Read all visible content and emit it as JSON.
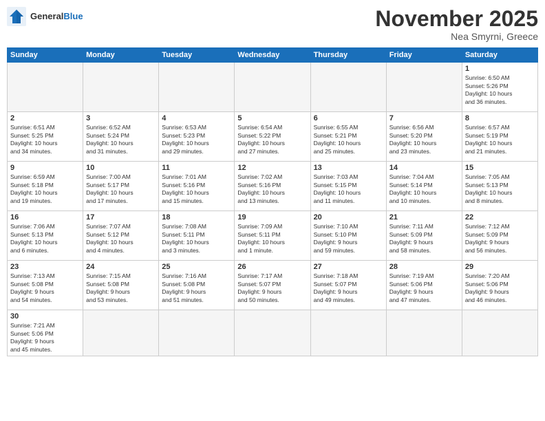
{
  "header": {
    "logo_general": "General",
    "logo_blue": "Blue",
    "month_title": "November 2025",
    "location": "Nea Smyrni, Greece"
  },
  "weekdays": [
    "Sunday",
    "Monday",
    "Tuesday",
    "Wednesday",
    "Thursday",
    "Friday",
    "Saturday"
  ],
  "weeks": [
    [
      {
        "day": "",
        "info": ""
      },
      {
        "day": "",
        "info": ""
      },
      {
        "day": "",
        "info": ""
      },
      {
        "day": "",
        "info": ""
      },
      {
        "day": "",
        "info": ""
      },
      {
        "day": "",
        "info": ""
      },
      {
        "day": "1",
        "info": "Sunrise: 6:50 AM\nSunset: 5:26 PM\nDaylight: 10 hours\nand 36 minutes."
      }
    ],
    [
      {
        "day": "2",
        "info": "Sunrise: 6:51 AM\nSunset: 5:25 PM\nDaylight: 10 hours\nand 34 minutes."
      },
      {
        "day": "3",
        "info": "Sunrise: 6:52 AM\nSunset: 5:24 PM\nDaylight: 10 hours\nand 31 minutes."
      },
      {
        "day": "4",
        "info": "Sunrise: 6:53 AM\nSunset: 5:23 PM\nDaylight: 10 hours\nand 29 minutes."
      },
      {
        "day": "5",
        "info": "Sunrise: 6:54 AM\nSunset: 5:22 PM\nDaylight: 10 hours\nand 27 minutes."
      },
      {
        "day": "6",
        "info": "Sunrise: 6:55 AM\nSunset: 5:21 PM\nDaylight: 10 hours\nand 25 minutes."
      },
      {
        "day": "7",
        "info": "Sunrise: 6:56 AM\nSunset: 5:20 PM\nDaylight: 10 hours\nand 23 minutes."
      },
      {
        "day": "8",
        "info": "Sunrise: 6:57 AM\nSunset: 5:19 PM\nDaylight: 10 hours\nand 21 minutes."
      }
    ],
    [
      {
        "day": "9",
        "info": "Sunrise: 6:59 AM\nSunset: 5:18 PM\nDaylight: 10 hours\nand 19 minutes."
      },
      {
        "day": "10",
        "info": "Sunrise: 7:00 AM\nSunset: 5:17 PM\nDaylight: 10 hours\nand 17 minutes."
      },
      {
        "day": "11",
        "info": "Sunrise: 7:01 AM\nSunset: 5:16 PM\nDaylight: 10 hours\nand 15 minutes."
      },
      {
        "day": "12",
        "info": "Sunrise: 7:02 AM\nSunset: 5:16 PM\nDaylight: 10 hours\nand 13 minutes."
      },
      {
        "day": "13",
        "info": "Sunrise: 7:03 AM\nSunset: 5:15 PM\nDaylight: 10 hours\nand 11 minutes."
      },
      {
        "day": "14",
        "info": "Sunrise: 7:04 AM\nSunset: 5:14 PM\nDaylight: 10 hours\nand 10 minutes."
      },
      {
        "day": "15",
        "info": "Sunrise: 7:05 AM\nSunset: 5:13 PM\nDaylight: 10 hours\nand 8 minutes."
      }
    ],
    [
      {
        "day": "16",
        "info": "Sunrise: 7:06 AM\nSunset: 5:13 PM\nDaylight: 10 hours\nand 6 minutes."
      },
      {
        "day": "17",
        "info": "Sunrise: 7:07 AM\nSunset: 5:12 PM\nDaylight: 10 hours\nand 4 minutes."
      },
      {
        "day": "18",
        "info": "Sunrise: 7:08 AM\nSunset: 5:11 PM\nDaylight: 10 hours\nand 3 minutes."
      },
      {
        "day": "19",
        "info": "Sunrise: 7:09 AM\nSunset: 5:11 PM\nDaylight: 10 hours\nand 1 minute."
      },
      {
        "day": "20",
        "info": "Sunrise: 7:10 AM\nSunset: 5:10 PM\nDaylight: 9 hours\nand 59 minutes."
      },
      {
        "day": "21",
        "info": "Sunrise: 7:11 AM\nSunset: 5:09 PM\nDaylight: 9 hours\nand 58 minutes."
      },
      {
        "day": "22",
        "info": "Sunrise: 7:12 AM\nSunset: 5:09 PM\nDaylight: 9 hours\nand 56 minutes."
      }
    ],
    [
      {
        "day": "23",
        "info": "Sunrise: 7:13 AM\nSunset: 5:08 PM\nDaylight: 9 hours\nand 54 minutes."
      },
      {
        "day": "24",
        "info": "Sunrise: 7:15 AM\nSunset: 5:08 PM\nDaylight: 9 hours\nand 53 minutes."
      },
      {
        "day": "25",
        "info": "Sunrise: 7:16 AM\nSunset: 5:08 PM\nDaylight: 9 hours\nand 51 minutes."
      },
      {
        "day": "26",
        "info": "Sunrise: 7:17 AM\nSunset: 5:07 PM\nDaylight: 9 hours\nand 50 minutes."
      },
      {
        "day": "27",
        "info": "Sunrise: 7:18 AM\nSunset: 5:07 PM\nDaylight: 9 hours\nand 49 minutes."
      },
      {
        "day": "28",
        "info": "Sunrise: 7:19 AM\nSunset: 5:06 PM\nDaylight: 9 hours\nand 47 minutes."
      },
      {
        "day": "29",
        "info": "Sunrise: 7:20 AM\nSunset: 5:06 PM\nDaylight: 9 hours\nand 46 minutes."
      }
    ],
    [
      {
        "day": "30",
        "info": "Sunrise: 7:21 AM\nSunset: 5:06 PM\nDaylight: 9 hours\nand 45 minutes."
      },
      {
        "day": "",
        "info": ""
      },
      {
        "day": "",
        "info": ""
      },
      {
        "day": "",
        "info": ""
      },
      {
        "day": "",
        "info": ""
      },
      {
        "day": "",
        "info": ""
      },
      {
        "day": "",
        "info": ""
      }
    ]
  ]
}
